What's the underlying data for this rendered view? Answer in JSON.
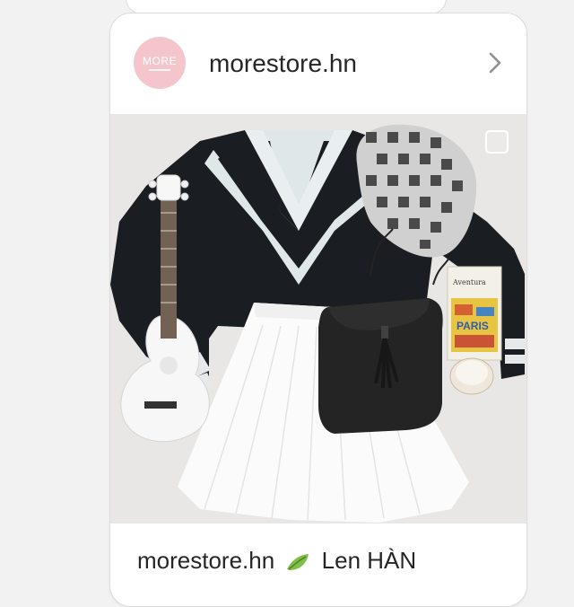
{
  "post": {
    "avatar_text": "MORE",
    "username": "morestore.hn",
    "caption": {
      "username": "morestore.hn",
      "text": "Len HÀN"
    }
  },
  "photo": {
    "subject": "flat-lay outfit",
    "book_title_1": "Aventura",
    "book_title_2": "PARIS"
  },
  "icons": {
    "chevron": "chevron-right-icon",
    "leaf": "leaf-emoji-icon",
    "select": "checkbox-icon"
  },
  "colors": {
    "avatar_bg": "#f4c6cc",
    "text": "#262626",
    "chevron": "#8e8e8e"
  }
}
